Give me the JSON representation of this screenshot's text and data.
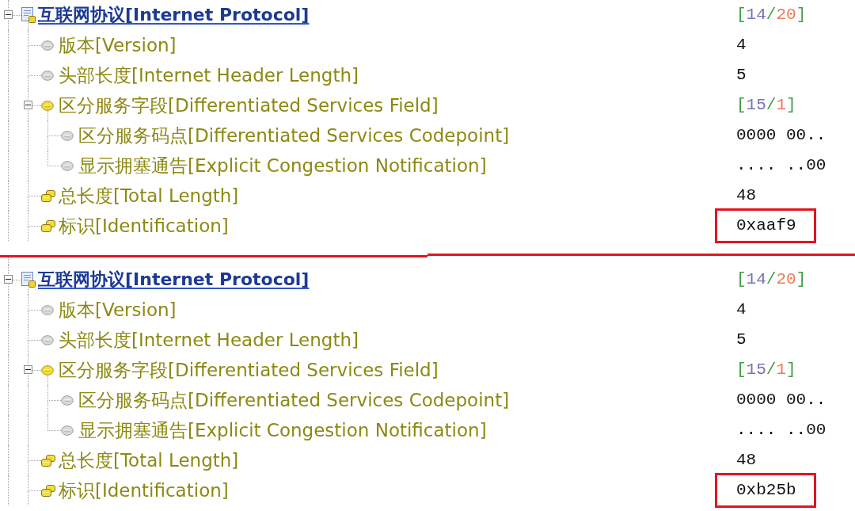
{
  "panels": [
    {
      "protocol_tree": {
        "kind": "protocol",
        "label": "互联网协议[Internet Protocol]",
        "expanded": true,
        "value_parts": [
          "[",
          "14",
          "/",
          "20",
          "]"
        ],
        "highlighted": false,
        "children": [
          {
            "kind": "field",
            "label": "版本[Version]",
            "value": "4",
            "highlighted": false
          },
          {
            "kind": "field",
            "label": "头部长度[Internet Header Length]",
            "value": "5",
            "highlighted": false
          },
          {
            "kind": "group",
            "label": "区分服务字段[Differentiated Services Field]",
            "expanded": true,
            "value_parts": [
              "[",
              "15",
              "/",
              "1",
              "]"
            ],
            "highlighted": false,
            "children": [
              {
                "kind": "field",
                "label": "区分服务码点[Differentiated Services Codepoint]",
                "value": "0000 00..",
                "highlighted": false
              },
              {
                "kind": "field",
                "label": "显示拥塞通告[Explicit Congestion Notification]",
                "value": ".... ..00",
                "highlighted": false
              }
            ]
          },
          {
            "kind": "multibyte",
            "label": "总长度[Total Length]",
            "value": "48",
            "highlighted": false
          },
          {
            "kind": "multibyte",
            "label": "标识[Identification]",
            "value": "0xaaf9",
            "highlighted": true
          }
        ]
      }
    },
    {
      "protocol_tree": {
        "kind": "protocol",
        "label": "互联网协议[Internet Protocol]",
        "expanded": true,
        "value_parts": [
          "[",
          "14",
          "/",
          "20",
          "]"
        ],
        "highlighted": false,
        "children": [
          {
            "kind": "field",
            "label": "版本[Version]",
            "value": "4",
            "highlighted": false
          },
          {
            "kind": "field",
            "label": "头部长度[Internet Header Length]",
            "value": "5",
            "highlighted": false
          },
          {
            "kind": "group",
            "label": "区分服务字段[Differentiated Services Field]",
            "expanded": true,
            "value_parts": [
              "[",
              "15",
              "/",
              "1",
              "]"
            ],
            "highlighted": false,
            "children": [
              {
                "kind": "field",
                "label": "区分服务码点[Differentiated Services Codepoint]",
                "value": "0000 00..",
                "highlighted": false
              },
              {
                "kind": "field",
                "label": "显示拥塞通告[Explicit Congestion Notification]",
                "value": ".... ..00",
                "highlighted": false
              }
            ]
          },
          {
            "kind": "multibyte",
            "label": "总长度[Total Length]",
            "value": "48",
            "highlighted": false
          },
          {
            "kind": "multibyte",
            "label": "标识[Identification]",
            "value": "0xb25b",
            "highlighted": true
          }
        ]
      }
    }
  ]
}
